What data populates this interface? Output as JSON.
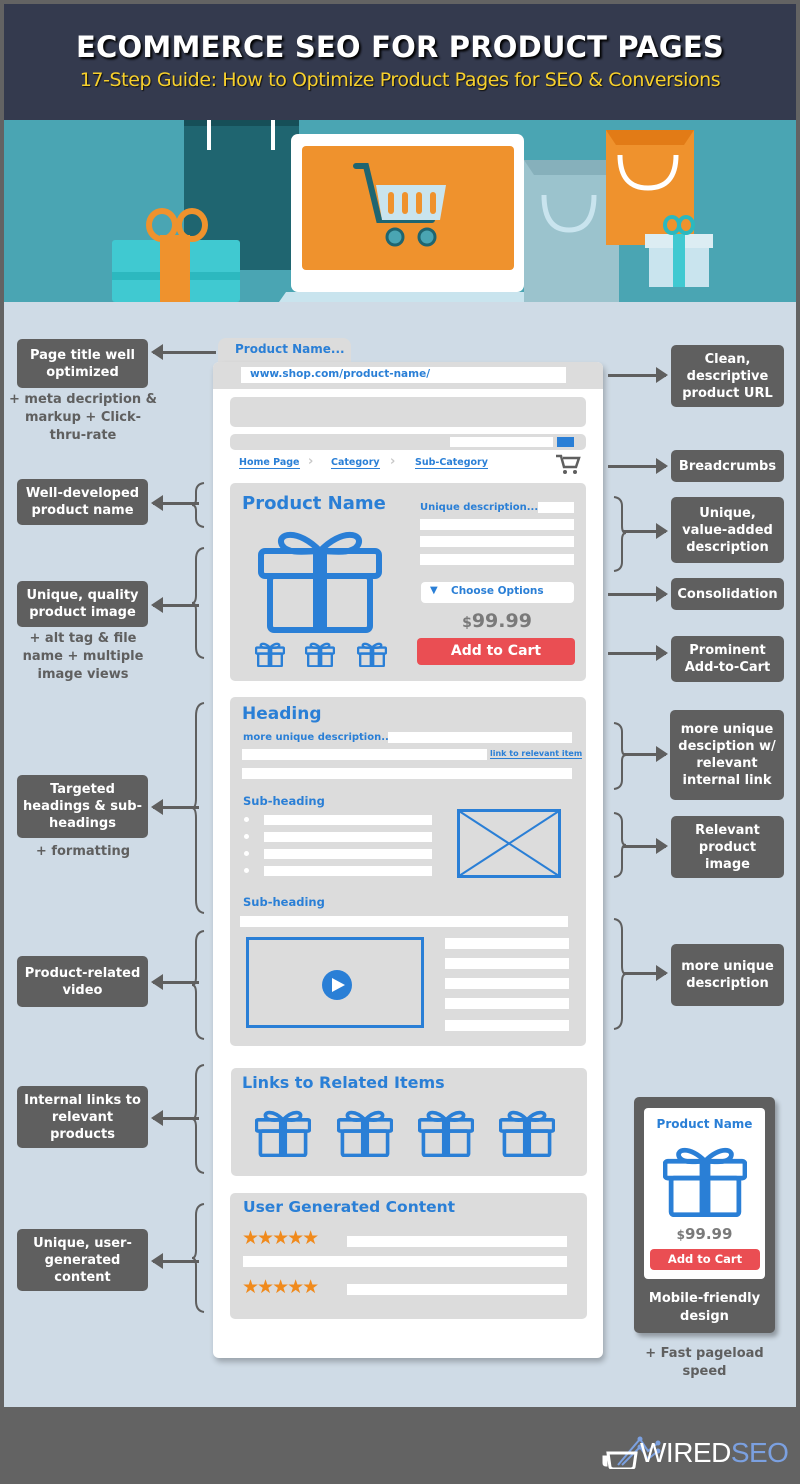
{
  "header": {
    "title": "ECOMMERCE SEO FOR PRODUCT PAGES",
    "subtitle": "17-Step Guide: How to Optimize Product Pages for SEO & Conversions"
  },
  "colors": {
    "header_bg": "#343a4e",
    "subtitle": "#f7d02c",
    "hero_bg": "#4aa5b3",
    "main_bg": "#cfdbe6",
    "label_bg": "#5f5f5f",
    "accent_blue": "#2a7fd6",
    "cart_red": "#ea4e53",
    "star_orange": "#f08a1c"
  },
  "browser": {
    "tab_title": "Product Name...",
    "url": "www.shop.com/product-name/",
    "breadcrumbs": [
      "Home Page",
      "Category",
      "Sub-Category"
    ],
    "product": {
      "name": "Product Name",
      "description_label": "Unique description...",
      "options_label": "Choose Options",
      "price_symbol": "$",
      "price": "99.99",
      "cart_button": "Add to Cart"
    },
    "content": {
      "heading": "Heading",
      "desc_label": "more unique description...",
      "link_label": "link to relevant item",
      "subheading_1": "Sub-heading",
      "subheading_2": "Sub-heading"
    },
    "related": {
      "heading": "Links to Related Items"
    },
    "ugc": {
      "heading": "User Generated Content",
      "reviews": [
        {
          "stars": 5
        },
        {
          "stars": 5
        }
      ],
      "star_glyphs": "★★★★★"
    }
  },
  "left_labels": [
    {
      "text": "Page title well optimized",
      "note": "+ meta decription & markup + Click-thru-rate"
    },
    {
      "text": "Well-developed product name"
    },
    {
      "text": "Unique, quality product image",
      "note": "+ alt tag & file name + multiple image views"
    },
    {
      "text": "Targeted headings & sub-headings",
      "note": "+ formatting"
    },
    {
      "text": "Product-related video"
    },
    {
      "text": "Internal links to relevant products"
    },
    {
      "text": "Unique, user-generated content"
    }
  ],
  "right_labels": [
    {
      "text": "Clean, descriptive product URL"
    },
    {
      "text": "Breadcrumbs"
    },
    {
      "text": "Unique, value-added description"
    },
    {
      "text": "Consolidation"
    },
    {
      "text": "Prominent Add-to-Cart"
    },
    {
      "text": "more unique desciption w/ relevant internal link"
    },
    {
      "text": "Relevant product image"
    },
    {
      "text": "more unique description"
    }
  ],
  "mobile": {
    "product_name": "Product Name",
    "price_symbol": "$",
    "price": "99.99",
    "cart_button": "Add to Cart",
    "label": "Mobile-friendly design",
    "note": "+ Fast pageload speed"
  },
  "footer": {
    "brand_a": "WIRED",
    "brand_b": "SEO"
  }
}
